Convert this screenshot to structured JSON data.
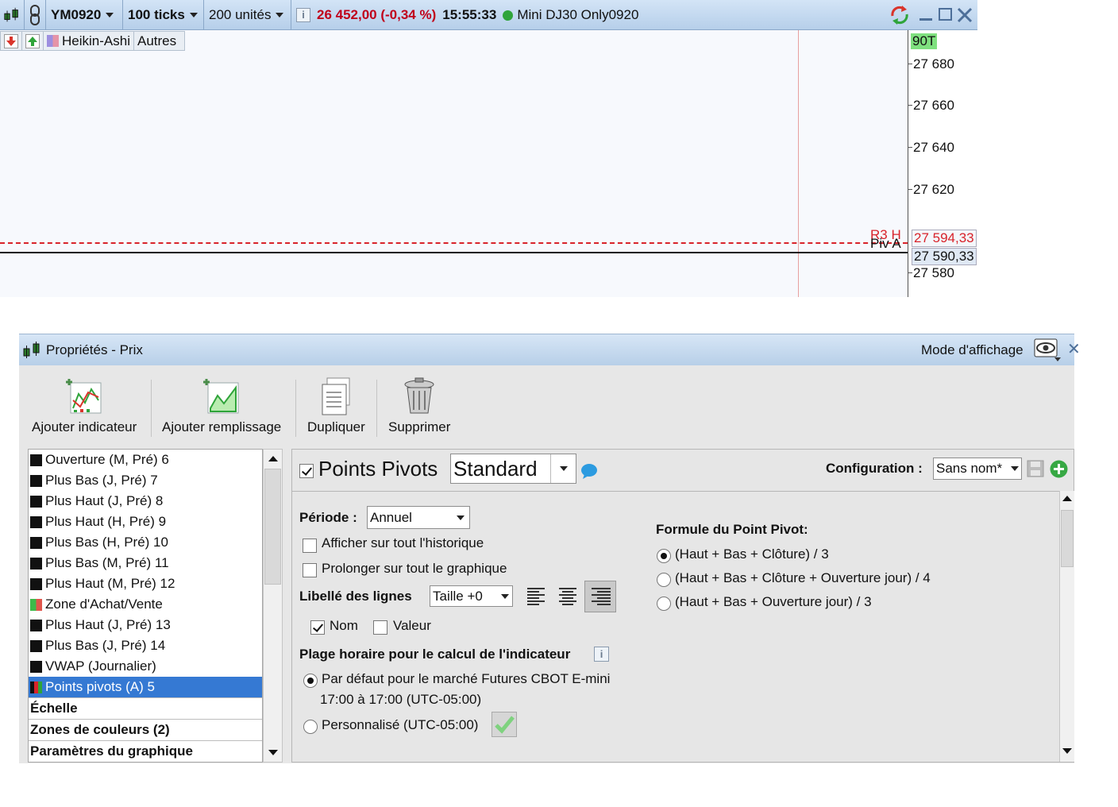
{
  "topbar": {
    "symbol": "YM0920",
    "period": "100 ticks",
    "units": "200 unités",
    "price": "26 452,00 (-0,34 %)",
    "time": "15:55:33",
    "instrument": "Mini DJ30 Only0920"
  },
  "row2": {
    "chart_type": "Heikin-Ashi",
    "others": "Autres"
  },
  "chart": {
    "top_tag": "90T",
    "axis_ticks": [
      "27 680",
      "27 660",
      "27 640",
      "27 620",
      "27 580"
    ],
    "r3_label": "R3 H",
    "r3_value": "27 594,33",
    "piv_label": "Piv A",
    "piv_value": "27 590,33",
    "colors": {
      "r3": "#d8232a",
      "piv": "#111111",
      "cursor": "#e7a0a0"
    }
  },
  "props": {
    "title": "Propriétés - Prix",
    "display_mode": "Mode d'affichage",
    "toolbar": {
      "add_indicator": "Ajouter indicateur",
      "add_fill": "Ajouter remplissage",
      "duplicate": "Dupliquer",
      "delete": "Supprimer"
    },
    "list": [
      {
        "label": "Ouverture (M, Pré) 6"
      },
      {
        "label": "Plus Bas (J, Pré) 7"
      },
      {
        "label": "Plus Haut (J, Pré) 8"
      },
      {
        "label": "Plus Haut (H, Pré) 9"
      },
      {
        "label": "Plus Bas (H, Pré) 10"
      },
      {
        "label": "Plus Bas (M, Pré) 11"
      },
      {
        "label": "Plus Haut (M, Pré) 12"
      },
      {
        "label": "Zone d'Achat/Vente"
      },
      {
        "label": "Plus Haut (J, Pré) 13"
      },
      {
        "label": "Plus Bas (J, Pré) 14"
      },
      {
        "label": "VWAP (Journalier)"
      },
      {
        "label": "Points pivots (A) 5"
      }
    ],
    "sections": [
      "Échelle",
      "Zones de couleurs (2)",
      "Paramètres du graphique"
    ],
    "indicator": {
      "name": "Points Pivots",
      "preset": "Standard",
      "config_label": "Configuration :",
      "config_value": "Sans nom*"
    },
    "form": {
      "period_label": "Période :",
      "period_value": "Annuel",
      "show_history": "Afficher sur tout l'historique",
      "extend_chart": "Prolonger sur tout le graphique",
      "line_labels": "Libellé des lignes",
      "size": "Taille +0",
      "name_opt": "Nom",
      "value_opt": "Valeur",
      "time_range_title": "Plage horaire pour le calcul de l'indicateur",
      "default_opt": "Par défaut pour le marché Futures CBOT E-mini",
      "default_range": "17:00 à 17:00 (UTC-05:00)",
      "custom_opt": "Personnalisé (UTC-05:00)",
      "formula_title": "Formule du Point Pivot:",
      "formula_1": "(Haut + Bas + Clôture) / 3",
      "formula_2": "(Haut + Bas +  Clôture + Ouverture jour) / 4",
      "formula_3": "(Haut + Bas + Ouverture jour) / 3"
    }
  }
}
